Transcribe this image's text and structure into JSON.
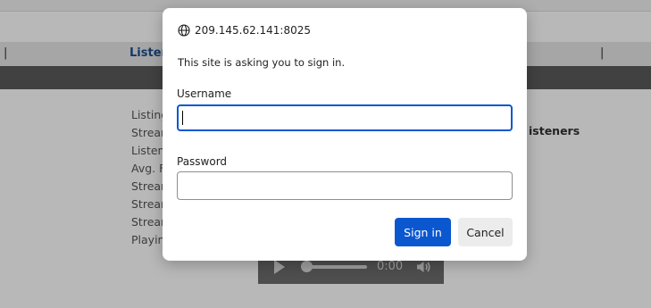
{
  "background": {
    "nav": {
      "separator": "|",
      "link": "Listen"
    },
    "info_items": [
      "Listing",
      "Strean",
      "Listen",
      "Avg. F",
      "Strean",
      "Strean",
      "Strean",
      "Playin"
    ],
    "listeners_heading": "isteners",
    "player": {
      "time": "0:00",
      "progress": 0
    }
  },
  "dialog": {
    "origin": "209.145.62.141:8025",
    "message": "This site is asking you to sign in.",
    "username": {
      "label": "Username",
      "value": ""
    },
    "password": {
      "label": "Password",
      "value": ""
    },
    "buttons": {
      "sign_in": "Sign in",
      "cancel": "Cancel"
    }
  },
  "colors": {
    "accent": "#0b57d0",
    "overlay": "rgba(0,0,0,0.28)",
    "nav_link": "#1f4e8f",
    "dark_bar": "#5a5a5a"
  },
  "icons": [
    "globe-icon",
    "play-icon",
    "volume-icon"
  ]
}
